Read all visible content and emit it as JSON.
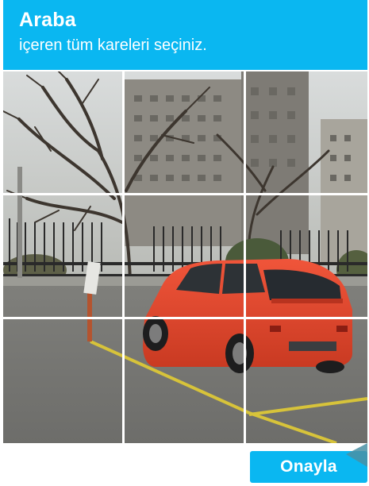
{
  "header": {
    "title": "Araba",
    "instruction": "içeren tüm kareleri seçiniz."
  },
  "tiles": [
    {
      "index": 1,
      "row": 1,
      "col": 1,
      "selected": false
    },
    {
      "index": 2,
      "row": 1,
      "col": 2,
      "selected": false
    },
    {
      "index": 3,
      "row": 1,
      "col": 3,
      "selected": false
    },
    {
      "index": 4,
      "row": 2,
      "col": 1,
      "selected": false
    },
    {
      "index": 5,
      "row": 2,
      "col": 2,
      "selected": false
    },
    {
      "index": 6,
      "row": 2,
      "col": 3,
      "selected": false
    },
    {
      "index": 7,
      "row": 3,
      "col": 1,
      "selected": false
    },
    {
      "index": 8,
      "row": 3,
      "col": 2,
      "selected": false
    },
    {
      "index": 9,
      "row": 3,
      "col": 3,
      "selected": false
    }
  ],
  "footer": {
    "verify_label": "Onayla"
  },
  "colors": {
    "accent": "#0ab7f1",
    "header_text": "#ffffff",
    "car": "#e8452a"
  },
  "icons": {
    "corner": "corner-arrow-icon"
  }
}
